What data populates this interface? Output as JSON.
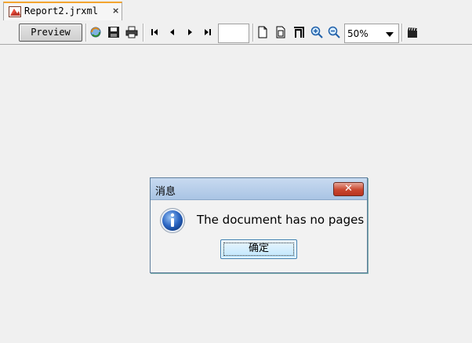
{
  "tab": {
    "title": "Report2.jrxml",
    "close_glyph": "×"
  },
  "toolbar": {
    "preview_label": "Preview",
    "page_field_value": "",
    "zoom_value": "50%",
    "icons": [
      "reload-icon",
      "save-icon",
      "print-icon",
      "first-page-icon",
      "previous-page-icon",
      "next-page-icon",
      "last-page-icon",
      "actual-size-icon",
      "fit-page-icon",
      "fit-width-icon",
      "zoom-in-icon",
      "zoom-out-icon",
      "clapper-icon"
    ]
  },
  "dialog": {
    "title": "消息",
    "message": "The document has no pages",
    "ok_label": "确定",
    "close_glyph": "✕"
  }
}
